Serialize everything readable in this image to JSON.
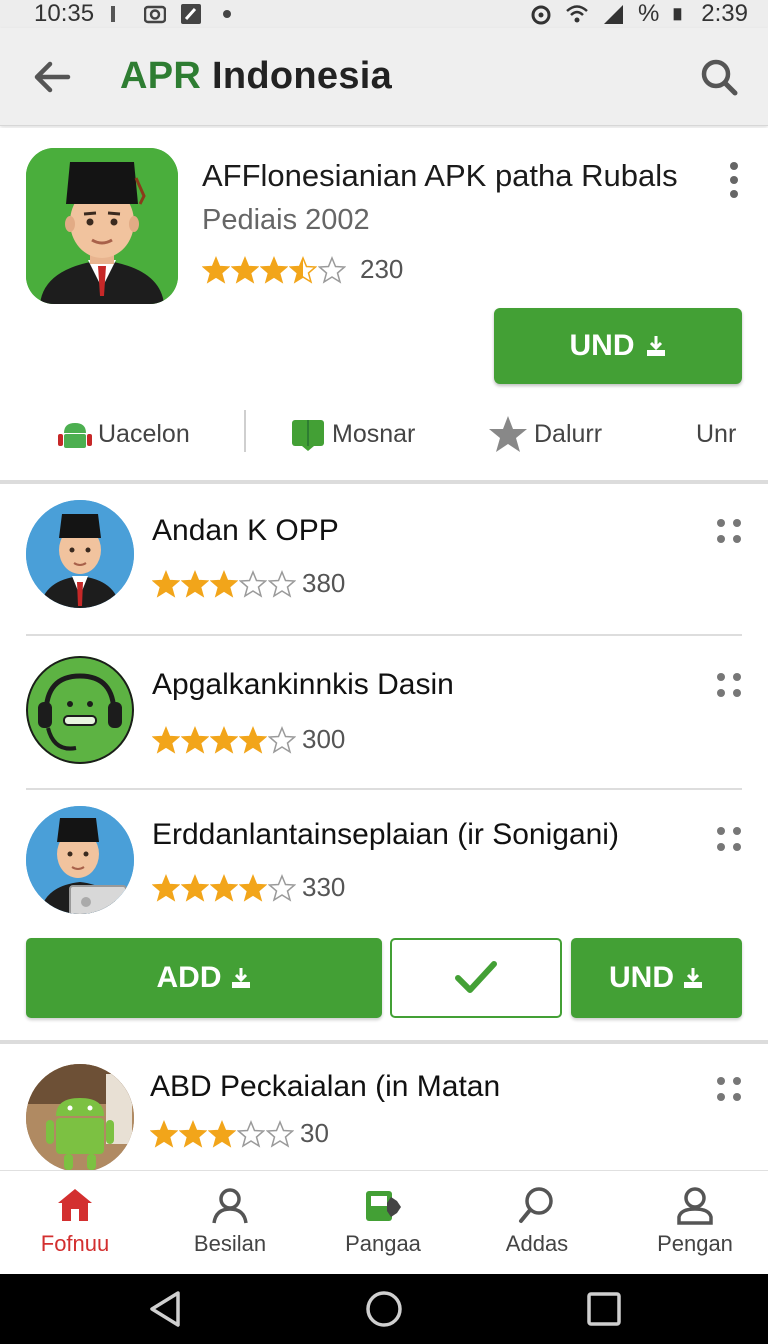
{
  "status_bar": {
    "time_left": "10:35",
    "battery": "%",
    "time_right": "2:39"
  },
  "app_bar": {
    "title_accent": "APR",
    "title_rest": " Indonesia",
    "back_icon": "arrow-back-icon",
    "search_icon": "search-icon"
  },
  "featured": {
    "title": "AFFlonesianian APK patha Rubals",
    "subtitle": "Pediais 2002",
    "rating": 3.5,
    "rating_count": "230",
    "install_label": "UND",
    "tabs": [
      {
        "label": "Uacelon",
        "icon": "android-icon"
      },
      {
        "label": "Mosnar",
        "icon": "book-icon"
      },
      {
        "label": "Dalurr",
        "icon": "star-icon"
      },
      {
        "label": "Unr",
        "icon": ""
      }
    ]
  },
  "apps": [
    {
      "title": "Andan K OPP",
      "rating": 3,
      "rating_count": "380",
      "avatar": "man-blue"
    },
    {
      "title": "Apgalkankinnkis Dasin",
      "rating": 4,
      "rating_count": "300",
      "avatar": "headset-green"
    },
    {
      "title": "Erddanlantainseplaian (ir Sonigani)",
      "rating": 4,
      "rating_count": "330",
      "avatar": "man-laptop"
    },
    {
      "title": "ABD Peckaialan (in Matan",
      "rating": 3,
      "rating_count": "30",
      "avatar": "android-photo"
    }
  ],
  "actions": {
    "add_label": "ADD",
    "install_label": "UND"
  },
  "bottom_nav": [
    {
      "label": "Fofnuu",
      "icon": "home-icon",
      "active": true
    },
    {
      "label": "Besilan",
      "icon": "person-icon",
      "active": false
    },
    {
      "label": "Pangaa",
      "icon": "apps-icon",
      "active": false
    },
    {
      "label": "Addas",
      "icon": "search-icon",
      "active": false
    },
    {
      "label": "Pengan",
      "icon": "account-icon",
      "active": false
    }
  ],
  "colors": {
    "accent_green": "#43a035",
    "title_green": "#2e7d32",
    "star_gold": "#f2a51a",
    "active_red": "#d32f2f"
  }
}
